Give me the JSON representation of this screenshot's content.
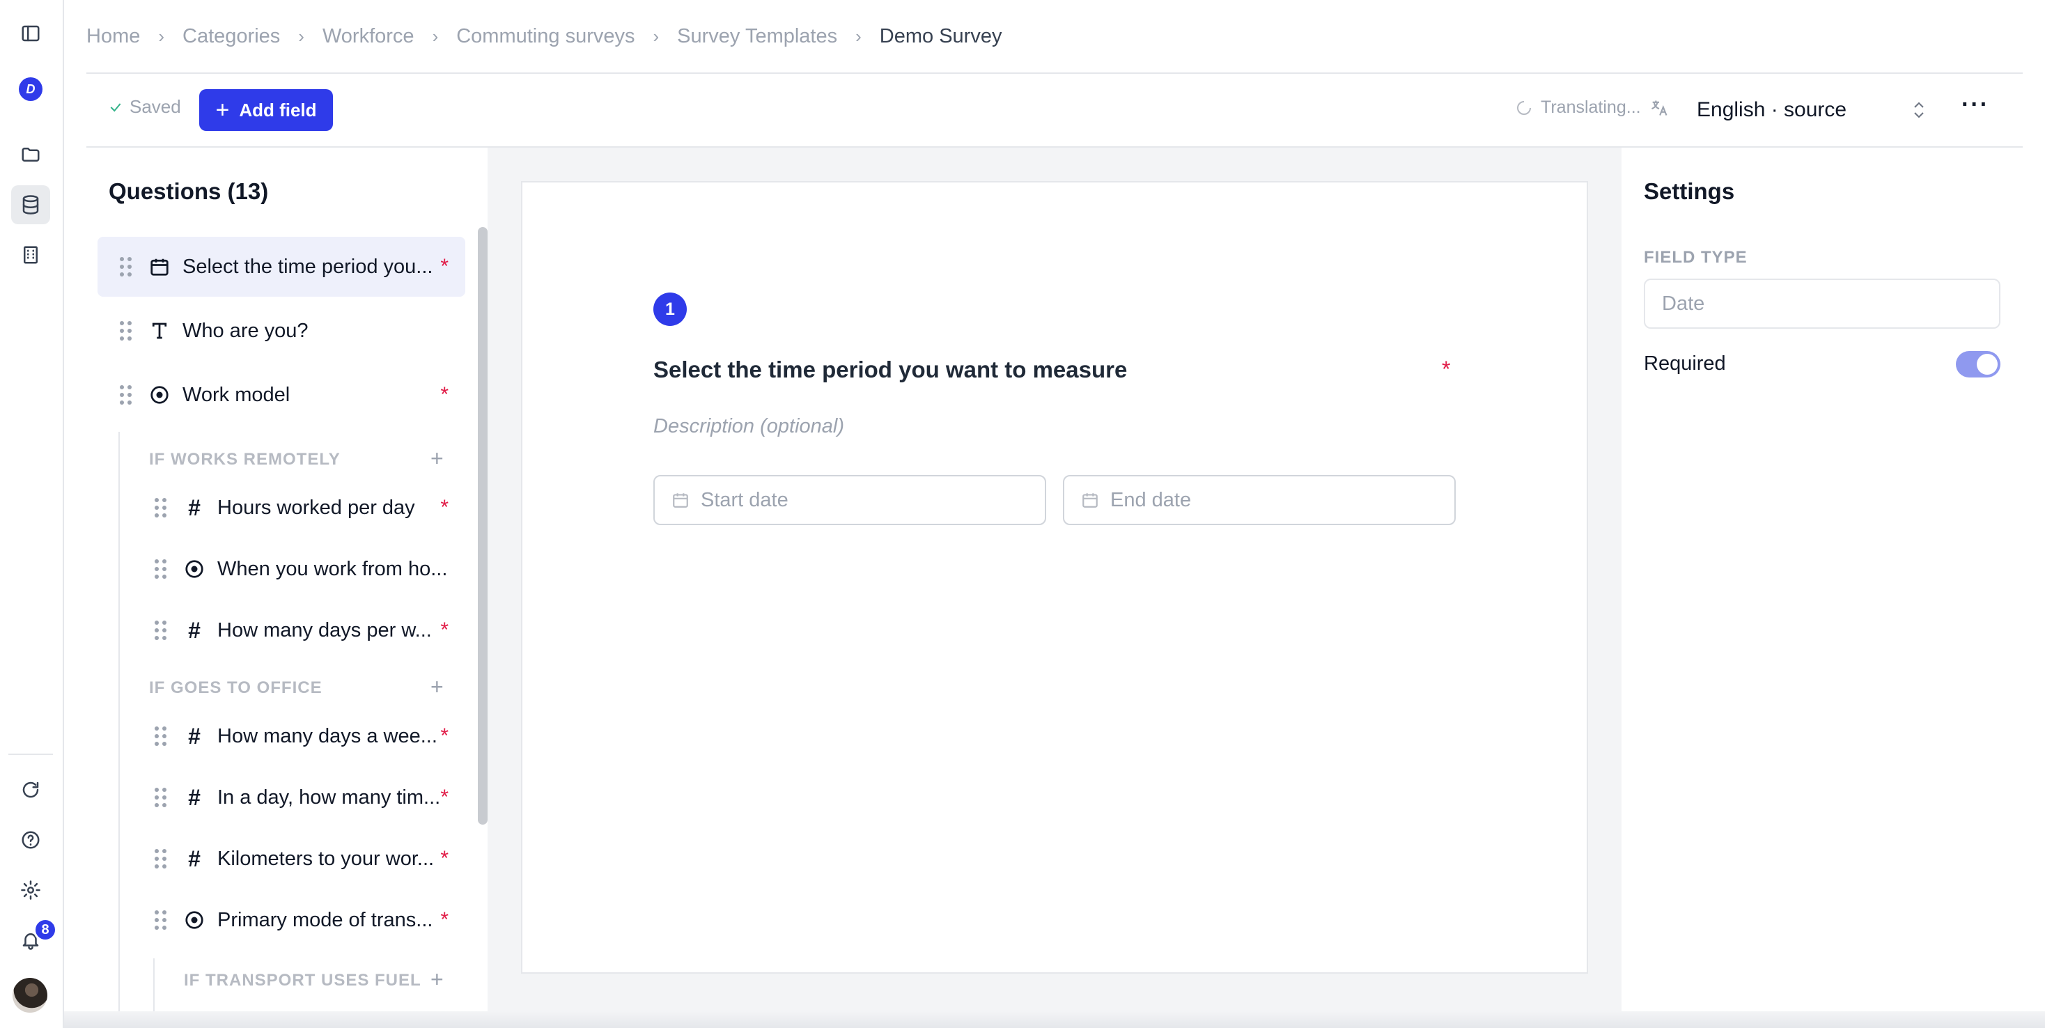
{
  "breadcrumb": [
    "Home",
    "Categories",
    "Workforce",
    "Commuting surveys",
    "Survey Templates",
    "Demo Survey"
  ],
  "toolbar": {
    "saved_label": "Saved",
    "add_field_label": "Add field",
    "translating_label": "Translating...",
    "language_label": "English · source",
    "more_label": "···"
  },
  "rail": {
    "notification_count": "8",
    "logo_glyph": "D"
  },
  "questions": {
    "title": "Questions (13)",
    "items": [
      {
        "label": "Select the time period you...",
        "icon": "calendar-icon",
        "required": "*"
      },
      {
        "label": "Who are you?",
        "icon": "text-icon",
        "required": ""
      },
      {
        "label": "Work model",
        "icon": "radio-icon",
        "required": "*"
      }
    ],
    "group_remote": {
      "title": "IF WORKS REMOTELY",
      "items": [
        {
          "label": "Hours worked per day",
          "icon": "number-icon",
          "required": "*"
        },
        {
          "label": "When you work from ho...",
          "icon": "radio-icon",
          "required": ""
        },
        {
          "label": "How many days per w...",
          "icon": "number-icon",
          "required": "*"
        }
      ]
    },
    "group_office": {
      "title": "IF GOES TO OFFICE",
      "items": [
        {
          "label": "How many days a wee...",
          "icon": "number-icon",
          "required": "*"
        },
        {
          "label": "In a day, how many tim...",
          "icon": "number-icon",
          "required": "*"
        },
        {
          "label": "Kilometers to your wor...",
          "icon": "number-icon",
          "required": "*"
        },
        {
          "label": "Primary mode of trans...",
          "icon": "radio-icon",
          "required": "*"
        }
      ]
    },
    "group_fuel": {
      "title": "IF TRANSPORT USES FUEL"
    },
    "add_glyph": "+"
  },
  "editor": {
    "number": "1",
    "heading": "Select the time period you want to measure",
    "required_mark": "*",
    "description_placeholder": "Description (optional)",
    "start_placeholder": "Start date",
    "end_placeholder": "End date"
  },
  "settings": {
    "title": "Settings",
    "field_type_label": "FIELD TYPE",
    "field_type_value": "Date",
    "required_label": "Required",
    "required_on": true
  },
  "colors": {
    "accent": "#2f3be9",
    "required": "#e11d48",
    "toggle_on": "#8f99ef"
  }
}
